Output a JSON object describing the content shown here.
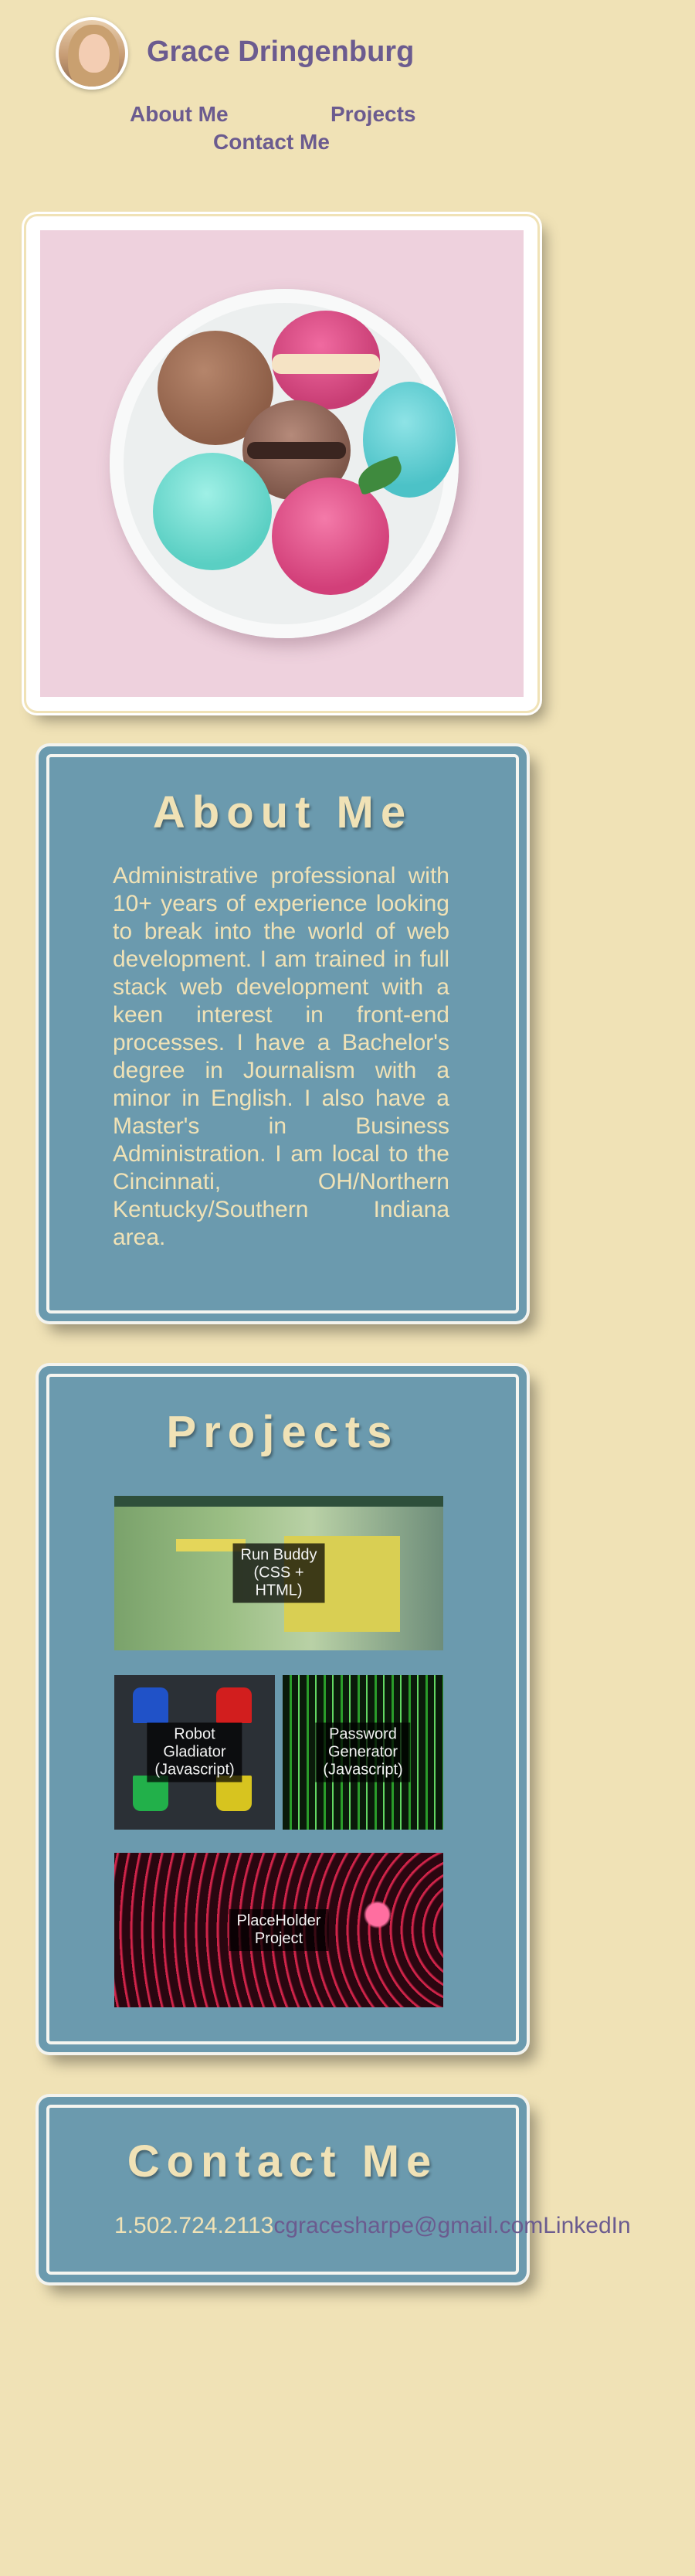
{
  "header": {
    "name": "Grace Dringenburg",
    "nav": [
      "About Me",
      "Projects",
      "Contact Me"
    ]
  },
  "about": {
    "title": "About Me",
    "text": "Administrative professional with 10+ years of experience looking to break into the world of web development. I am trained in full stack web development with a keen interest in front-end processes. I have a Bachelor's degree in Journalism with a minor in English. I also have a Master's in Business Administration. I am local to the Cincinnati, OH/Northern Kentucky/Southern Indiana area."
  },
  "projects": {
    "title": "Projects",
    "items": [
      {
        "label_lines": [
          "Run Buddy",
          "(CSS +",
          "HTML)"
        ]
      },
      {
        "label_lines": [
          "Robot",
          "Gladiator",
          "(Javascript)"
        ]
      },
      {
        "label_lines": [
          "Password",
          "Generator",
          "(Javascript)"
        ]
      },
      {
        "label_lines": [
          "PlaceHolder",
          "Project"
        ]
      }
    ]
  },
  "contact": {
    "title": "Contact Me",
    "phone": "1.502.724.2113",
    "email": "cgracesharpe@gmail.com",
    "linkedin": "LinkedIn"
  },
  "colors": {
    "background": "#f0e2b6",
    "card": "#6b9aae",
    "heading_text": "#f0e2b6",
    "link": "#6b5b8f"
  }
}
